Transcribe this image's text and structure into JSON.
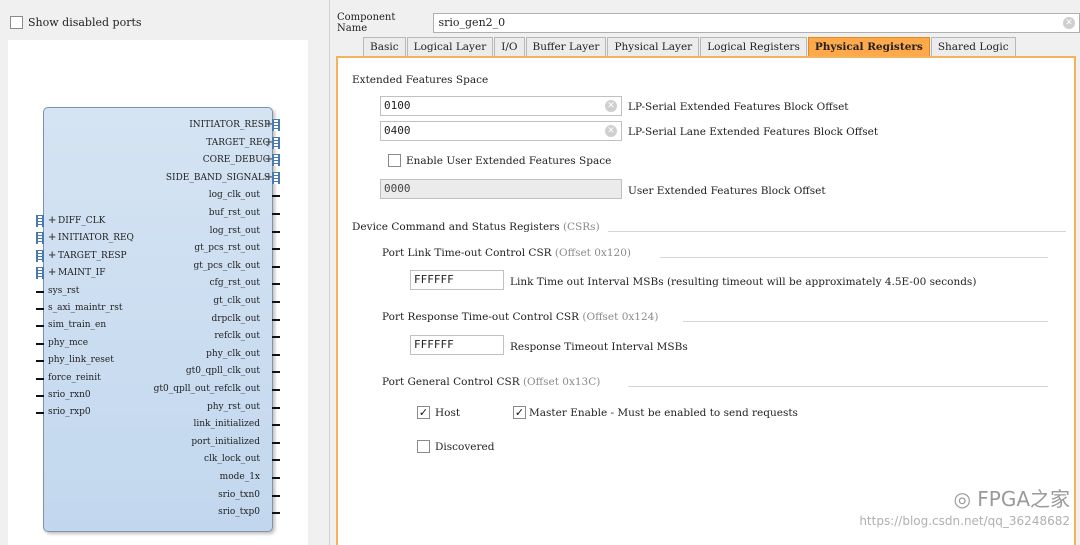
{
  "left": {
    "show_disabled_label": "Show disabled ports",
    "block": {
      "right_pins": [
        "INITIATOR_RESP",
        "TARGET_REQ",
        "CORE_DEBUG",
        "SIDE_BAND_SIGNALS",
        "log_clk_out",
        "buf_rst_out",
        "log_rst_out",
        "gt_pcs_rst_out",
        "gt_pcs_clk_out",
        "cfg_rst_out",
        "gt_clk_out",
        "drpclk_out",
        "refclk_out",
        "phy_clk_out",
        "gt0_qpll_clk_out",
        "gt0_qpll_out_refclk_out",
        "phy_rst_out",
        "link_initialized",
        "port_initialized",
        "clk_lock_out",
        "mode_1x",
        "srio_txn0",
        "srio_txp0"
      ],
      "left_pins": [
        "DIFF_CLK",
        "INITIATOR_REQ",
        "TARGET_RESP",
        "MAINT_IF",
        "sys_rst",
        "s_axi_maintr_rst",
        "sim_train_en",
        "phy_mce",
        "phy_link_reset",
        "force_reinit",
        "srio_rxn0",
        "srio_rxp0"
      ]
    }
  },
  "component": {
    "label": "Component Name",
    "value": "srio_gen2_0"
  },
  "tabs": [
    "Basic",
    "Logical Layer",
    "I/O",
    "Buffer Layer",
    "Physical Layer",
    "Logical Registers",
    "Physical Registers",
    "Shared Logic"
  ],
  "active_tab": "Physical Registers",
  "ext": {
    "title": "Extended Features Space",
    "lp_serial_value": "0100",
    "lp_serial_label": "LP-Serial Extended Features Block Offset",
    "lp_lane_value": "0400",
    "lp_lane_label": "LP-Serial Lane Extended Features Block Offset",
    "enable_user_label": "Enable User Extended Features Space",
    "user_offset_value": "0000",
    "user_offset_label": "User Extended Features Block Offset"
  },
  "csr": {
    "title": "Device Command and Status Registers",
    "title_suffix": "(CSRs)",
    "link_timeout": {
      "title": "Port Link Time-out Control CSR",
      "offset": "(Offset 0x120)",
      "value": "FFFFFF",
      "label": "Link Time out Interval MSBs (resulting timeout will be approximately 4.5E-00 seconds)"
    },
    "resp_timeout": {
      "title": "Port Response Time-out Control CSR",
      "offset": "(Offset 0x124)",
      "value": "FFFFFF",
      "label": "Response Timeout Interval MSBs"
    },
    "general": {
      "title": "Port General Control CSR",
      "offset": "(Offset 0x13C)",
      "host_label": "Host",
      "master_label": "Master Enable - Must be enabled to send requests",
      "discovered_label": "Discovered"
    }
  },
  "watermark": {
    "logo_text": "FPGA之家",
    "url": "https://blog.csdn.net/qq_36248682"
  },
  "icons": {
    "clear": "clear-icon",
    "check": "check-icon",
    "bus_plus": "plus-icon",
    "wechat": "wechat-icon"
  }
}
